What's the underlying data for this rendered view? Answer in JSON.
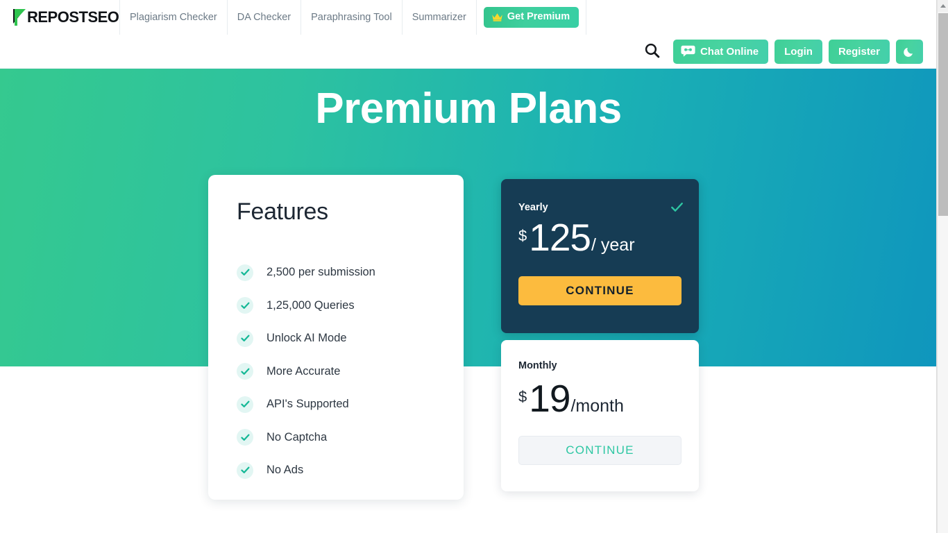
{
  "header": {
    "logo": {
      "text": "REPOSTSEO",
      "icon": "prepostseo-logo-icon"
    },
    "nav": [
      {
        "label": "Plagiarism Checker"
      },
      {
        "label": "DA Checker"
      },
      {
        "label": "Paraphrasing Tool"
      },
      {
        "label": "Summarizer"
      }
    ],
    "premium_button": {
      "label": "Get Premium",
      "icon": "crown-icon",
      "color": "#3ecf9e"
    },
    "actions": {
      "search_icon": "search-icon",
      "chat": {
        "label": "Chat Online",
        "icon": "robot-icon"
      },
      "login": {
        "label": "Login"
      },
      "register": {
        "label": "Register"
      },
      "theme_toggle": {
        "icon": "moon-icon"
      }
    }
  },
  "hero": {
    "title": "Premium Plans",
    "gradient_from": "#35c98f",
    "gradient_to": "#0f96bd"
  },
  "features": {
    "title": "Features",
    "items": [
      {
        "label": "2,500 per submission"
      },
      {
        "label": "1,25,000 Queries"
      },
      {
        "label": "Unlock AI Mode"
      },
      {
        "label": "More Accurate"
      },
      {
        "label": "API's Supported"
      },
      {
        "label": "No Captcha"
      },
      {
        "label": "No Ads"
      }
    ]
  },
  "plans": [
    {
      "id": "yearly",
      "label": "Yearly",
      "currency": "$",
      "amount": "125",
      "period": "/ year",
      "cta": "CONTINUE",
      "selected": true,
      "card_color": "#163c54",
      "cta_color": "#fcbb3e"
    },
    {
      "id": "monthly",
      "label": "Monthly",
      "currency": "$",
      "amount": "19",
      "period": "/month",
      "cta": "CONTINUE",
      "selected": false,
      "card_color": "#ffffff",
      "cta_color": "#f3f5f8"
    }
  ]
}
